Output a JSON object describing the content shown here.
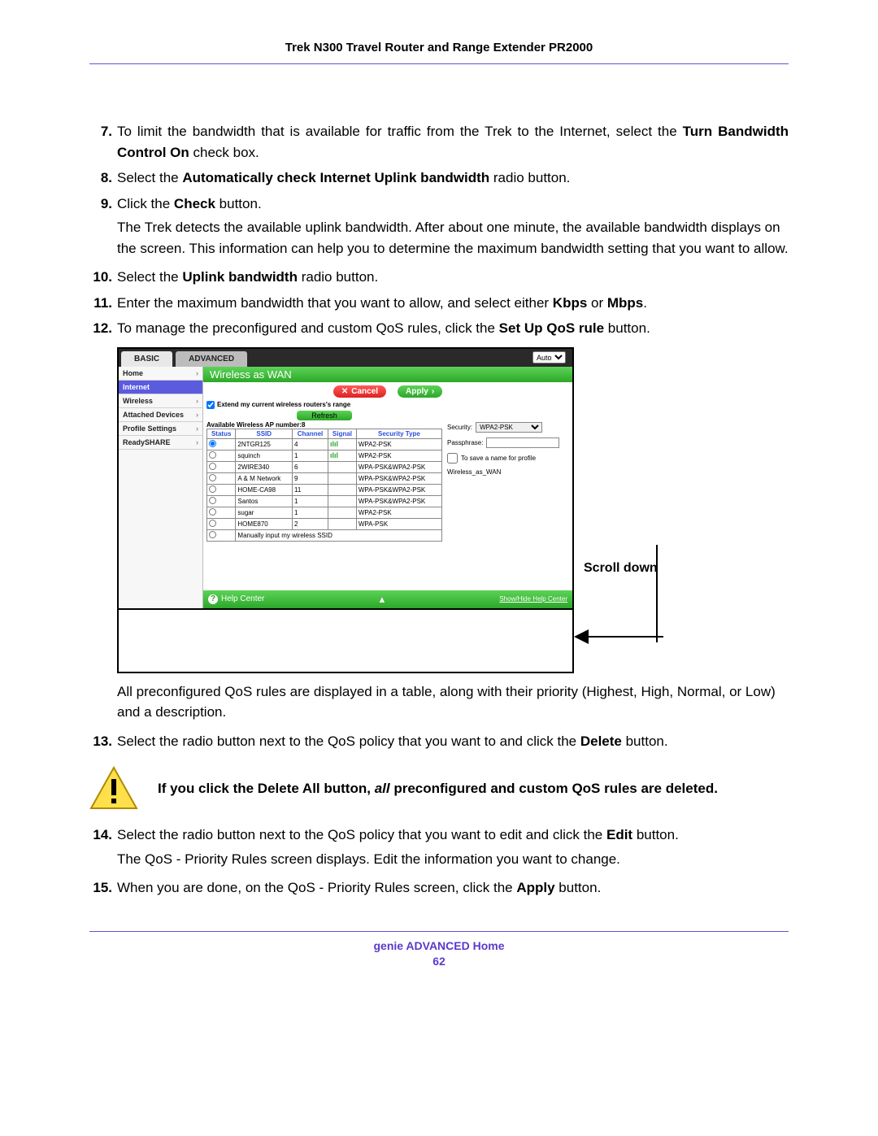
{
  "header": {
    "title": "Trek N300 Travel Router and Range Extender PR2000"
  },
  "steps": {
    "s7": {
      "num": "7.",
      "pre": "To limit the bandwidth that is available for traffic from the Trek to the Internet, select the ",
      "bold": "Turn Bandwidth Control On",
      "post": " check box."
    },
    "s8": {
      "num": "8.",
      "pre": "Select the ",
      "bold": "Automatically check Internet Uplink bandwidth",
      "post": " radio button."
    },
    "s9": {
      "num": "9.",
      "pre": "Click the ",
      "bold": "Check",
      "post": " button.",
      "extra": "The Trek detects the available uplink bandwidth. After about one minute, the available bandwidth displays on the screen. This information can help you to determine the maximum bandwidth setting that you want to allow."
    },
    "s10": {
      "num": "10.",
      "pre": "Select the ",
      "bold": "Uplink bandwidth",
      "post": " radio button."
    },
    "s11": {
      "num": "11.",
      "pre": "Enter the maximum bandwidth that you want to allow, and select either ",
      "bold1": "Kbps",
      "mid": " or ",
      "bold2": "Mbps",
      "post": "."
    },
    "s12": {
      "num": "12.",
      "pre": "To manage the preconfigured and custom QoS rules, click the ",
      "bold": "Set Up QoS rule",
      "post": " button."
    },
    "after12": "All preconfigured QoS rules are displayed in a table, along with their priority (Highest, High, Normal, or Low) and a description.",
    "s13": {
      "num": "13.",
      "pre": "Select the radio button next to the QoS policy that you want to and click the ",
      "bold": "Delete",
      "post": " button."
    },
    "warn": {
      "t1": "If you click the Delete All button, ",
      "t2": "all",
      "t3": " preconfigured and custom QoS rules are deleted."
    },
    "s14": {
      "num": "14.",
      "pre": "Select the radio button next to the QoS policy that you want to edit and click the ",
      "bold": "Edit",
      "post": " button.",
      "extra": "The QoS - Priority Rules screen displays. Edit the information you want to change."
    },
    "s15": {
      "num": "15.",
      "pre": "When you are done, on the QoS - Priority Rules screen, click the ",
      "bold": "Apply",
      "post": " button."
    }
  },
  "shot": {
    "tabs": {
      "basic": "BASIC",
      "advanced": "ADVANCED",
      "auto": "Auto"
    },
    "sidebar": {
      "home": "Home",
      "internet": "Internet",
      "wireless": "Wireless",
      "attached": "Attached Devices",
      "profile": "Profile Settings",
      "ready": "ReadySHARE"
    },
    "title": "Wireless as WAN",
    "buttons": {
      "cancel": "Cancel",
      "apply": "Apply",
      "refresh": "Refresh"
    },
    "chk_extend": "Extend my current wireless routers's range",
    "ap_label": "Available Wireless AP number:8",
    "cols": {
      "status": "Status",
      "ssid": "SSID",
      "channel": "Channel",
      "signal": "Signal",
      "security": "Security Type"
    },
    "rows": [
      {
        "ssid": "2NTGR125",
        "ch": "4",
        "sig": "ılıl",
        "sec": "WPA2-PSK",
        "sel": true
      },
      {
        "ssid": "squinch",
        "ch": "1",
        "sig": "ılıl",
        "sec": "WPA2-PSK"
      },
      {
        "ssid": "2WIRE340",
        "ch": "6",
        "sig": "",
        "sec": "WPA-PSK&WPA2-PSK"
      },
      {
        "ssid": "A & M Network",
        "ch": "9",
        "sig": "",
        "sec": "WPA-PSK&WPA2-PSK"
      },
      {
        "ssid": "HOME-CA98",
        "ch": "11",
        "sig": "",
        "sec": "WPA-PSK&WPA2-PSK"
      },
      {
        "ssid": "Santos",
        "ch": "1",
        "sig": "",
        "sec": "WPA-PSK&WPA2-PSK"
      },
      {
        "ssid": "sugar",
        "ch": "1",
        "sig": "",
        "sec": "WPA2-PSK"
      },
      {
        "ssid": "HOME870",
        "ch": "2",
        "sig": "",
        "sec": "WPA-PSK"
      },
      {
        "ssid": "Manually input my wireless SSID",
        "ch": "",
        "sig": "",
        "sec": "",
        "span": true
      }
    ],
    "form": {
      "sec_label": "Security:",
      "sec_value": "WPA2-PSK",
      "pass_label": "Passphrase:",
      "save_label": "To save a name for profile",
      "profile_name": "Wireless_as_WAN"
    },
    "help": "Help Center",
    "showhide": "Show/Hide Help Center"
  },
  "scroll_label": "Scroll down",
  "footer": {
    "section": "genie ADVANCED Home",
    "page": "62"
  }
}
